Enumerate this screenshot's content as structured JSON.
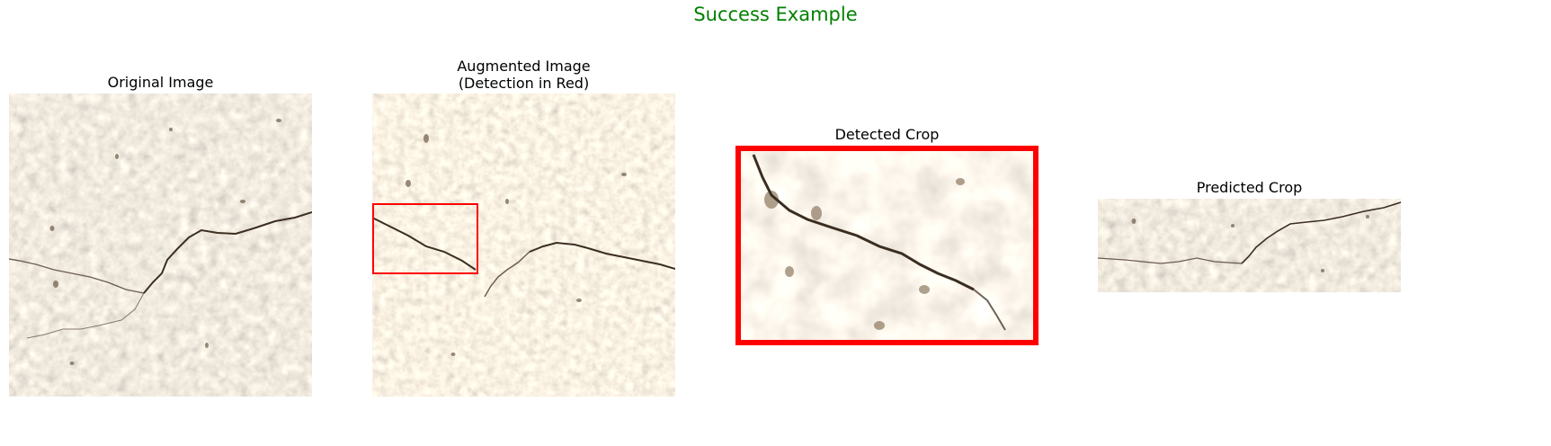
{
  "figure": {
    "suptitle": "Success Example",
    "suptitle_color": "#008000"
  },
  "panels": [
    {
      "title_line1": "Original Image"
    },
    {
      "title_line1": "Augmented Image",
      "title_line2": "(Detection in Red)"
    },
    {
      "title_line1": "Detected Crop"
    },
    {
      "title_line1": "Predicted Crop"
    }
  ],
  "detection_box_color": "#ff0000"
}
